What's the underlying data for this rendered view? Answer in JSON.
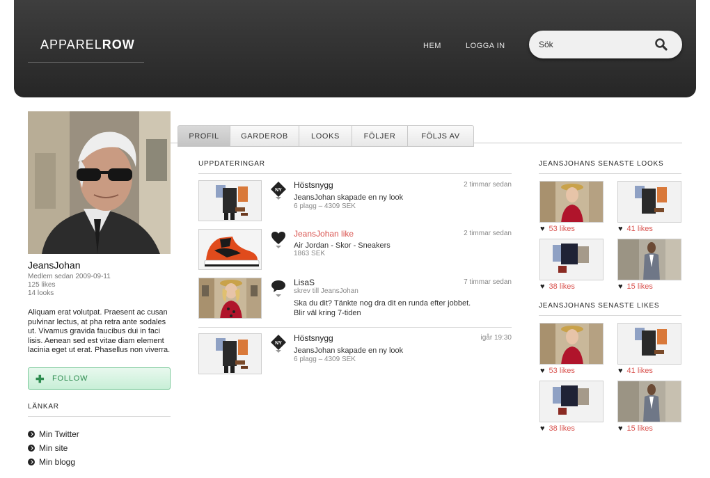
{
  "header": {
    "logo_light": "APPAREL",
    "logo_bold": "ROW",
    "nav": [
      "HEM",
      "LOGGA IN"
    ],
    "search_placeholder": "Sök"
  },
  "profile": {
    "username": "JeansJohan",
    "member_since": "Medlem sedan 2009-09-11",
    "likes": "125 likes",
    "looks": "14 looks",
    "bio": "Aliquam erat volutpat. Praesent ac cusan pulvinar lectus, at pha retra ante sodales ut. Vivamus gravida faucibus dui in faci lisis. Aenean sed est vitae diam element lacinia eget ut erat. Phasellus non viverra.",
    "follow_label": "FOLLOW",
    "links_title": "LÄNKAR",
    "links": [
      "Min Twitter",
      "Min site",
      "Min blogg"
    ]
  },
  "tabs": [
    "PROFIL",
    "GARDEROB",
    "LOOKS",
    "FÖLJER",
    "FÖLJS AV"
  ],
  "feed": {
    "title": "UPPDATERINGAR",
    "items": [
      {
        "title": "Höstsnygg",
        "time": "2 timmar sedan",
        "desc": "JeansJohan skapade en ny look",
        "sub": "6 plagg – 4309 SEK",
        "icon": "ny-badge-icon",
        "thumb": "outfit"
      },
      {
        "title": "JeansJohan like",
        "time": "2 timmar sedan",
        "desc": "Air Jordan - Skor - Sneakers",
        "sub": "1863 SEK",
        "icon": "heart-icon",
        "thumb": "sneaker"
      },
      {
        "title": "LisaS",
        "time": "7 timmar sedan",
        "sub": "skrev till JeansJohan",
        "desc": "Ska du dit? Tänkte nog dra dit en runda efter jobbet.",
        "desc2": "Blir väl kring 7-tiden",
        "icon": "speech-bubble-icon",
        "thumb": "woman"
      },
      {
        "title": "Höstsnygg",
        "time": "igår 19:30",
        "desc": "JeansJohan skapade en ny look",
        "sub": "6 plagg – 4309 SEK",
        "icon": "ny-badge-icon",
        "thumb": "outfit"
      }
    ]
  },
  "latest_looks": {
    "title": "JEANSJOHANS SENASTE LOOKS",
    "tiles": [
      {
        "likes": "53 likes",
        "thumb": "woman"
      },
      {
        "likes": "41 likes",
        "thumb": "outfit"
      },
      {
        "likes": "38 likes",
        "thumb": "jacket"
      },
      {
        "likes": "15 likes",
        "thumb": "man"
      }
    ]
  },
  "latest_likes": {
    "title": "JEANSJOHANS SENASTE LIKES",
    "tiles": [
      {
        "likes": "53 likes",
        "thumb": "woman"
      },
      {
        "likes": "41 likes",
        "thumb": "outfit"
      },
      {
        "likes": "38 likes",
        "thumb": "jacket"
      },
      {
        "likes": "15 likes",
        "thumb": "man"
      }
    ]
  },
  "colors": {
    "header_bg": "#2e2e2e",
    "accent_red": "#d9534f",
    "follow_green": "#2d8c4f"
  }
}
